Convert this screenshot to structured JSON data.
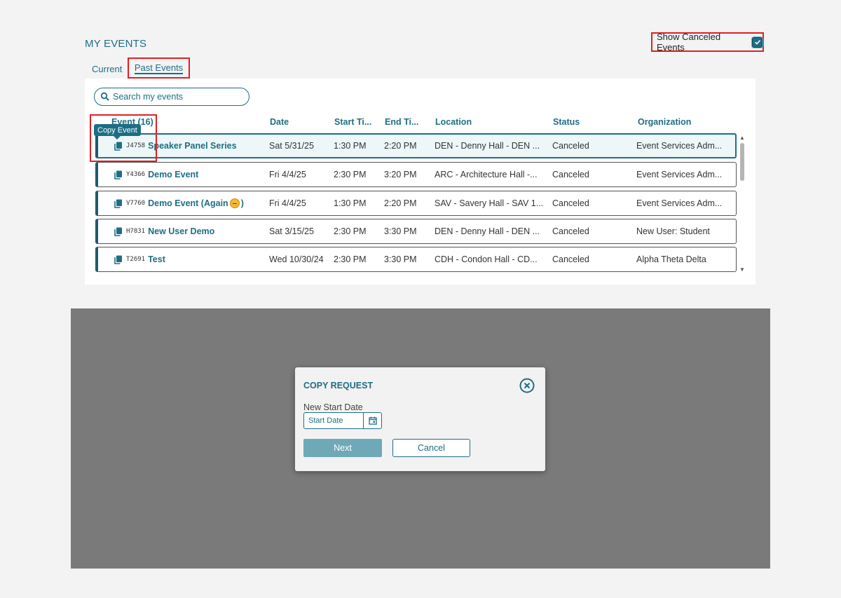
{
  "page": {
    "title": "MY EVENTS"
  },
  "show_canceled": {
    "label": "Show Canceled Events",
    "checked": true
  },
  "tabs": [
    {
      "label": "Current",
      "active": false
    },
    {
      "label": "Past Events",
      "active": true
    }
  ],
  "search": {
    "placeholder": "Search my events",
    "value": ""
  },
  "table": {
    "headers": {
      "event": "Event (16)",
      "date": "Date",
      "start": "Start Ti...",
      "end": "End Ti...",
      "location": "Location",
      "status": "Status",
      "organization": "Organization"
    },
    "rows": [
      {
        "code": "J4758",
        "name": "Speaker Panel Series",
        "date": "Sat 5/31/25",
        "start": "1:30 PM",
        "end": "2:20 PM",
        "location": "DEN - Denny Hall - DEN ...",
        "status": "Canceled",
        "organization": "Event Services Adm..."
      },
      {
        "code": "Y4366",
        "name": "Demo Event",
        "date": "Fri 4/4/25",
        "start": "2:30 PM",
        "end": "3:20 PM",
        "location": "ARC - Architecture Hall -...",
        "status": "Canceled",
        "organization": "Event Services Adm..."
      },
      {
        "code": "V7760",
        "name": "Demo Event (Again",
        "name_suffix": ")",
        "date": "Fri 4/4/25",
        "start": "1:30 PM",
        "end": "2:20 PM",
        "location": "SAV - Savery Hall - SAV 1...",
        "status": "Canceled",
        "organization": "Event Services Adm..."
      },
      {
        "code": "H7831",
        "name": "New User Demo",
        "date": "Sat 3/15/25",
        "start": "2:30 PM",
        "end": "3:30 PM",
        "location": "DEN - Denny Hall - DEN ...",
        "status": "Canceled",
        "organization": "New User: Student"
      },
      {
        "code": "T2691",
        "name": "Test",
        "date": "Wed 10/30/24",
        "start": "2:30 PM",
        "end": "3:30 PM",
        "location": "CDH - Condon Hall - CD...",
        "status": "Canceled",
        "organization": "Alpha Theta Delta"
      }
    ]
  },
  "tooltip": {
    "text": "Copy Event"
  },
  "modal": {
    "title": "COPY REQUEST",
    "date_label": "New Start Date",
    "date_placeholder": "Start Date",
    "next_label": "Next",
    "cancel_label": "Cancel"
  },
  "colors": {
    "accent": "#1d6e85",
    "highlight": "#e02020",
    "overlay": "#7a7a7a"
  },
  "icons": {
    "search": "search-icon",
    "copy": "copy-icon",
    "calendar": "calendar-icon",
    "close": "close-circle-icon",
    "check": "check-icon"
  }
}
